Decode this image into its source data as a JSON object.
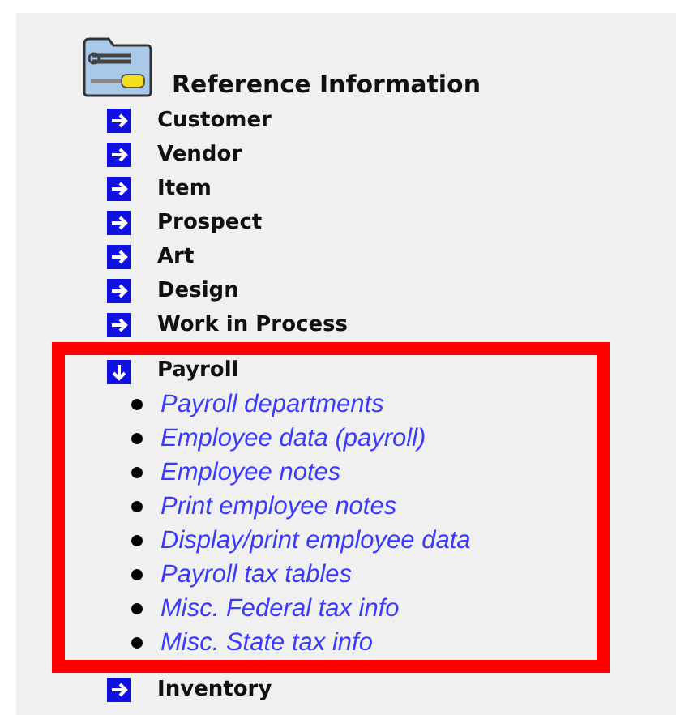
{
  "section": {
    "title": "Reference Information"
  },
  "items": [
    {
      "label": "Customer",
      "expanded": false
    },
    {
      "label": "Vendor",
      "expanded": false
    },
    {
      "label": "Item",
      "expanded": false
    },
    {
      "label": "Prospect",
      "expanded": false
    },
    {
      "label": "Art",
      "expanded": false
    },
    {
      "label": "Design",
      "expanded": false
    },
    {
      "label": "Work in Process",
      "expanded": false
    },
    {
      "label": "Payroll",
      "expanded": true,
      "children": [
        {
          "label": "Payroll departments"
        },
        {
          "label": "Employee data (payroll)"
        },
        {
          "label": "Employee notes"
        },
        {
          "label": "Print employee notes"
        },
        {
          "label": "Display/print employee data"
        },
        {
          "label": "Payroll tax tables"
        },
        {
          "label": "Misc. Federal tax info"
        },
        {
          "label": "Misc. State tax info"
        }
      ]
    },
    {
      "label": "Inventory",
      "expanded": false
    }
  ]
}
